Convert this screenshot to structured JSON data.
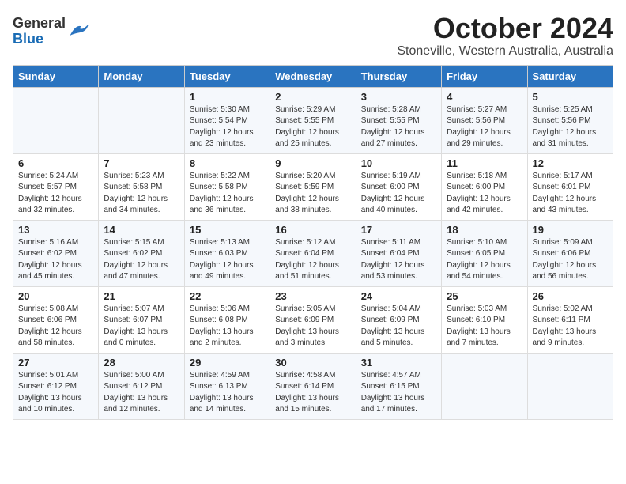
{
  "logo": {
    "general": "General",
    "blue": "Blue"
  },
  "title": "October 2024",
  "subtitle": "Stoneville, Western Australia, Australia",
  "headers": [
    "Sunday",
    "Monday",
    "Tuesday",
    "Wednesday",
    "Thursday",
    "Friday",
    "Saturday"
  ],
  "weeks": [
    [
      {
        "day": "",
        "lines": []
      },
      {
        "day": "",
        "lines": []
      },
      {
        "day": "1",
        "lines": [
          "Sunrise: 5:30 AM",
          "Sunset: 5:54 PM",
          "Daylight: 12 hours",
          "and 23 minutes."
        ]
      },
      {
        "day": "2",
        "lines": [
          "Sunrise: 5:29 AM",
          "Sunset: 5:55 PM",
          "Daylight: 12 hours",
          "and 25 minutes."
        ]
      },
      {
        "day": "3",
        "lines": [
          "Sunrise: 5:28 AM",
          "Sunset: 5:55 PM",
          "Daylight: 12 hours",
          "and 27 minutes."
        ]
      },
      {
        "day": "4",
        "lines": [
          "Sunrise: 5:27 AM",
          "Sunset: 5:56 PM",
          "Daylight: 12 hours",
          "and 29 minutes."
        ]
      },
      {
        "day": "5",
        "lines": [
          "Sunrise: 5:25 AM",
          "Sunset: 5:56 PM",
          "Daylight: 12 hours",
          "and 31 minutes."
        ]
      }
    ],
    [
      {
        "day": "6",
        "lines": [
          "Sunrise: 5:24 AM",
          "Sunset: 5:57 PM",
          "Daylight: 12 hours",
          "and 32 minutes."
        ]
      },
      {
        "day": "7",
        "lines": [
          "Sunrise: 5:23 AM",
          "Sunset: 5:58 PM",
          "Daylight: 12 hours",
          "and 34 minutes."
        ]
      },
      {
        "day": "8",
        "lines": [
          "Sunrise: 5:22 AM",
          "Sunset: 5:58 PM",
          "Daylight: 12 hours",
          "and 36 minutes."
        ]
      },
      {
        "day": "9",
        "lines": [
          "Sunrise: 5:20 AM",
          "Sunset: 5:59 PM",
          "Daylight: 12 hours",
          "and 38 minutes."
        ]
      },
      {
        "day": "10",
        "lines": [
          "Sunrise: 5:19 AM",
          "Sunset: 6:00 PM",
          "Daylight: 12 hours",
          "and 40 minutes."
        ]
      },
      {
        "day": "11",
        "lines": [
          "Sunrise: 5:18 AM",
          "Sunset: 6:00 PM",
          "Daylight: 12 hours",
          "and 42 minutes."
        ]
      },
      {
        "day": "12",
        "lines": [
          "Sunrise: 5:17 AM",
          "Sunset: 6:01 PM",
          "Daylight: 12 hours",
          "and 43 minutes."
        ]
      }
    ],
    [
      {
        "day": "13",
        "lines": [
          "Sunrise: 5:16 AM",
          "Sunset: 6:02 PM",
          "Daylight: 12 hours",
          "and 45 minutes."
        ]
      },
      {
        "day": "14",
        "lines": [
          "Sunrise: 5:15 AM",
          "Sunset: 6:02 PM",
          "Daylight: 12 hours",
          "and 47 minutes."
        ]
      },
      {
        "day": "15",
        "lines": [
          "Sunrise: 5:13 AM",
          "Sunset: 6:03 PM",
          "Daylight: 12 hours",
          "and 49 minutes."
        ]
      },
      {
        "day": "16",
        "lines": [
          "Sunrise: 5:12 AM",
          "Sunset: 6:04 PM",
          "Daylight: 12 hours",
          "and 51 minutes."
        ]
      },
      {
        "day": "17",
        "lines": [
          "Sunrise: 5:11 AM",
          "Sunset: 6:04 PM",
          "Daylight: 12 hours",
          "and 53 minutes."
        ]
      },
      {
        "day": "18",
        "lines": [
          "Sunrise: 5:10 AM",
          "Sunset: 6:05 PM",
          "Daylight: 12 hours",
          "and 54 minutes."
        ]
      },
      {
        "day": "19",
        "lines": [
          "Sunrise: 5:09 AM",
          "Sunset: 6:06 PM",
          "Daylight: 12 hours",
          "and 56 minutes."
        ]
      }
    ],
    [
      {
        "day": "20",
        "lines": [
          "Sunrise: 5:08 AM",
          "Sunset: 6:06 PM",
          "Daylight: 12 hours",
          "and 58 minutes."
        ]
      },
      {
        "day": "21",
        "lines": [
          "Sunrise: 5:07 AM",
          "Sunset: 6:07 PM",
          "Daylight: 13 hours",
          "and 0 minutes."
        ]
      },
      {
        "day": "22",
        "lines": [
          "Sunrise: 5:06 AM",
          "Sunset: 6:08 PM",
          "Daylight: 13 hours",
          "and 2 minutes."
        ]
      },
      {
        "day": "23",
        "lines": [
          "Sunrise: 5:05 AM",
          "Sunset: 6:09 PM",
          "Daylight: 13 hours",
          "and 3 minutes."
        ]
      },
      {
        "day": "24",
        "lines": [
          "Sunrise: 5:04 AM",
          "Sunset: 6:09 PM",
          "Daylight: 13 hours",
          "and 5 minutes."
        ]
      },
      {
        "day": "25",
        "lines": [
          "Sunrise: 5:03 AM",
          "Sunset: 6:10 PM",
          "Daylight: 13 hours",
          "and 7 minutes."
        ]
      },
      {
        "day": "26",
        "lines": [
          "Sunrise: 5:02 AM",
          "Sunset: 6:11 PM",
          "Daylight: 13 hours",
          "and 9 minutes."
        ]
      }
    ],
    [
      {
        "day": "27",
        "lines": [
          "Sunrise: 5:01 AM",
          "Sunset: 6:12 PM",
          "Daylight: 13 hours",
          "and 10 minutes."
        ]
      },
      {
        "day": "28",
        "lines": [
          "Sunrise: 5:00 AM",
          "Sunset: 6:12 PM",
          "Daylight: 13 hours",
          "and 12 minutes."
        ]
      },
      {
        "day": "29",
        "lines": [
          "Sunrise: 4:59 AM",
          "Sunset: 6:13 PM",
          "Daylight: 13 hours",
          "and 14 minutes."
        ]
      },
      {
        "day": "30",
        "lines": [
          "Sunrise: 4:58 AM",
          "Sunset: 6:14 PM",
          "Daylight: 13 hours",
          "and 15 minutes."
        ]
      },
      {
        "day": "31",
        "lines": [
          "Sunrise: 4:57 AM",
          "Sunset: 6:15 PM",
          "Daylight: 13 hours",
          "and 17 minutes."
        ]
      },
      {
        "day": "",
        "lines": []
      },
      {
        "day": "",
        "lines": []
      }
    ]
  ]
}
